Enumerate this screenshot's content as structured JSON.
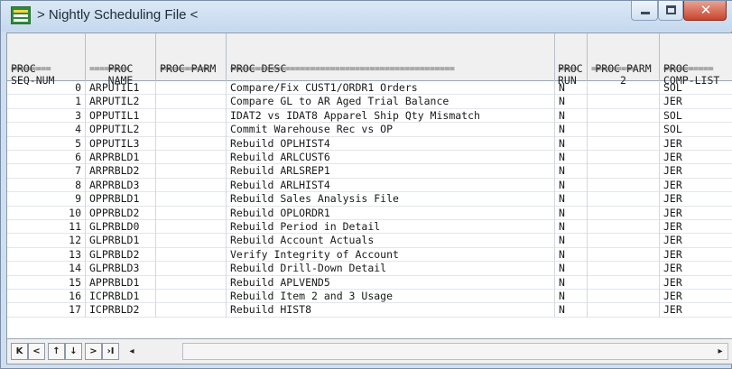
{
  "window": {
    "title": "> Nightly Scheduling File <",
    "close_glyph": "✕"
  },
  "columns": [
    {
      "line1": "PROC-",
      "line2": "SEQ-NUM",
      "sep": "========"
    },
    {
      "line1": "PROC",
      "line2": "NAME",
      "sep": "========"
    },
    {
      "line1": "",
      "line2": "PROC-PARM",
      "sep": "=========="
    },
    {
      "line1": "",
      "line2": "PROC-DESC",
      "sep": "============================================="
    },
    {
      "line1": "PROC",
      "line2": "RUN",
      "sep": "===="
    },
    {
      "line1": "PROC-PARM",
      "line2": "2",
      "sep": "========="
    },
    {
      "line1": "PROC-",
      "line2": "COMP-LIST",
      "sep": "=========="
    }
  ],
  "rows": [
    {
      "seq": "0",
      "name": "ARPUTIL1",
      "parm": "",
      "desc": "Compare/Fix CUST1/ORDR1 Orders",
      "run": "N",
      "parm2": "",
      "comp": "SOL"
    },
    {
      "seq": "1",
      "name": "ARPUTIL2",
      "parm": "",
      "desc": "Compare GL to AR Aged Trial Balance",
      "run": "N",
      "parm2": "",
      "comp": "JER"
    },
    {
      "seq": "3",
      "name": "OPPUTIL1",
      "parm": "",
      "desc": "IDAT2 vs IDAT8 Apparel Ship Qty Mismatch",
      "run": "N",
      "parm2": "",
      "comp": "SOL"
    },
    {
      "seq": "4",
      "name": "OPPUTIL2",
      "parm": "",
      "desc": "Commit Warehouse Rec vs OP",
      "run": "N",
      "parm2": "",
      "comp": "SOL"
    },
    {
      "seq": "5",
      "name": "OPPUTIL3",
      "parm": "",
      "desc": "Rebuild OPLHIST4",
      "run": "N",
      "parm2": "",
      "comp": "JER"
    },
    {
      "seq": "6",
      "name": "ARPRBLD1",
      "parm": "",
      "desc": "Rebuild ARLCUST6",
      "run": "N",
      "parm2": "",
      "comp": "JER"
    },
    {
      "seq": "7",
      "name": "ARPRBLD2",
      "parm": "",
      "desc": "Rebuild ARLSREP1",
      "run": "N",
      "parm2": "",
      "comp": "JER"
    },
    {
      "seq": "8",
      "name": "ARPRBLD3",
      "parm": "",
      "desc": "Rebuild ARLHIST4",
      "run": "N",
      "parm2": "",
      "comp": "JER"
    },
    {
      "seq": "9",
      "name": "OPPRBLD1",
      "parm": "",
      "desc": "Rebuild Sales Analysis File",
      "run": "N",
      "parm2": "",
      "comp": "JER"
    },
    {
      "seq": "10",
      "name": "OPPRBLD2",
      "parm": "",
      "desc": "Rebuild OPLORDR1",
      "run": "N",
      "parm2": "",
      "comp": "JER"
    },
    {
      "seq": "11",
      "name": "GLPRBLD0",
      "parm": "",
      "desc": "Rebuild Period in Detail",
      "run": "N",
      "parm2": "",
      "comp": "JER"
    },
    {
      "seq": "12",
      "name": "GLPRBLD1",
      "parm": "",
      "desc": "Rebuild Account Actuals",
      "run": "N",
      "parm2": "",
      "comp": "JER"
    },
    {
      "seq": "13",
      "name": "GLPRBLD2",
      "parm": "",
      "desc": "Verify Integrity of Account",
      "run": "N",
      "parm2": "",
      "comp": "JER"
    },
    {
      "seq": "14",
      "name": "GLPRBLD3",
      "parm": "",
      "desc": "Rebuild Drill-Down Detail",
      "run": "N",
      "parm2": "",
      "comp": "JER"
    },
    {
      "seq": "15",
      "name": "APPRBLD1",
      "parm": "",
      "desc": "Rebuild APLVEND5",
      "run": "N",
      "parm2": "",
      "comp": "JER"
    },
    {
      "seq": "16",
      "name": "ICPRBLD1",
      "parm": "",
      "desc": "Rebuild Item 2 and 3 Usage",
      "run": "N",
      "parm2": "",
      "comp": "JER"
    },
    {
      "seq": "17",
      "name": "ICPRBLD2",
      "parm": "",
      "desc": "Rebuild HIST8",
      "run": "N",
      "parm2": "",
      "comp": "JER"
    }
  ],
  "nav": {
    "first": "K",
    "prev": "<",
    "up": "↑",
    "down": "↓",
    "next": ">",
    "last": "›I",
    "scroll_left": "◂",
    "scroll_right": "▸"
  },
  "icons": {
    "app": "table-icon",
    "minimize": "minimize-icon",
    "maximize": "maximize-icon",
    "close": "close-icon"
  },
  "colors": {
    "titlebar": "#c5d8ee",
    "close_button": "#c8442d",
    "header_bg": "#f0f0f0"
  }
}
